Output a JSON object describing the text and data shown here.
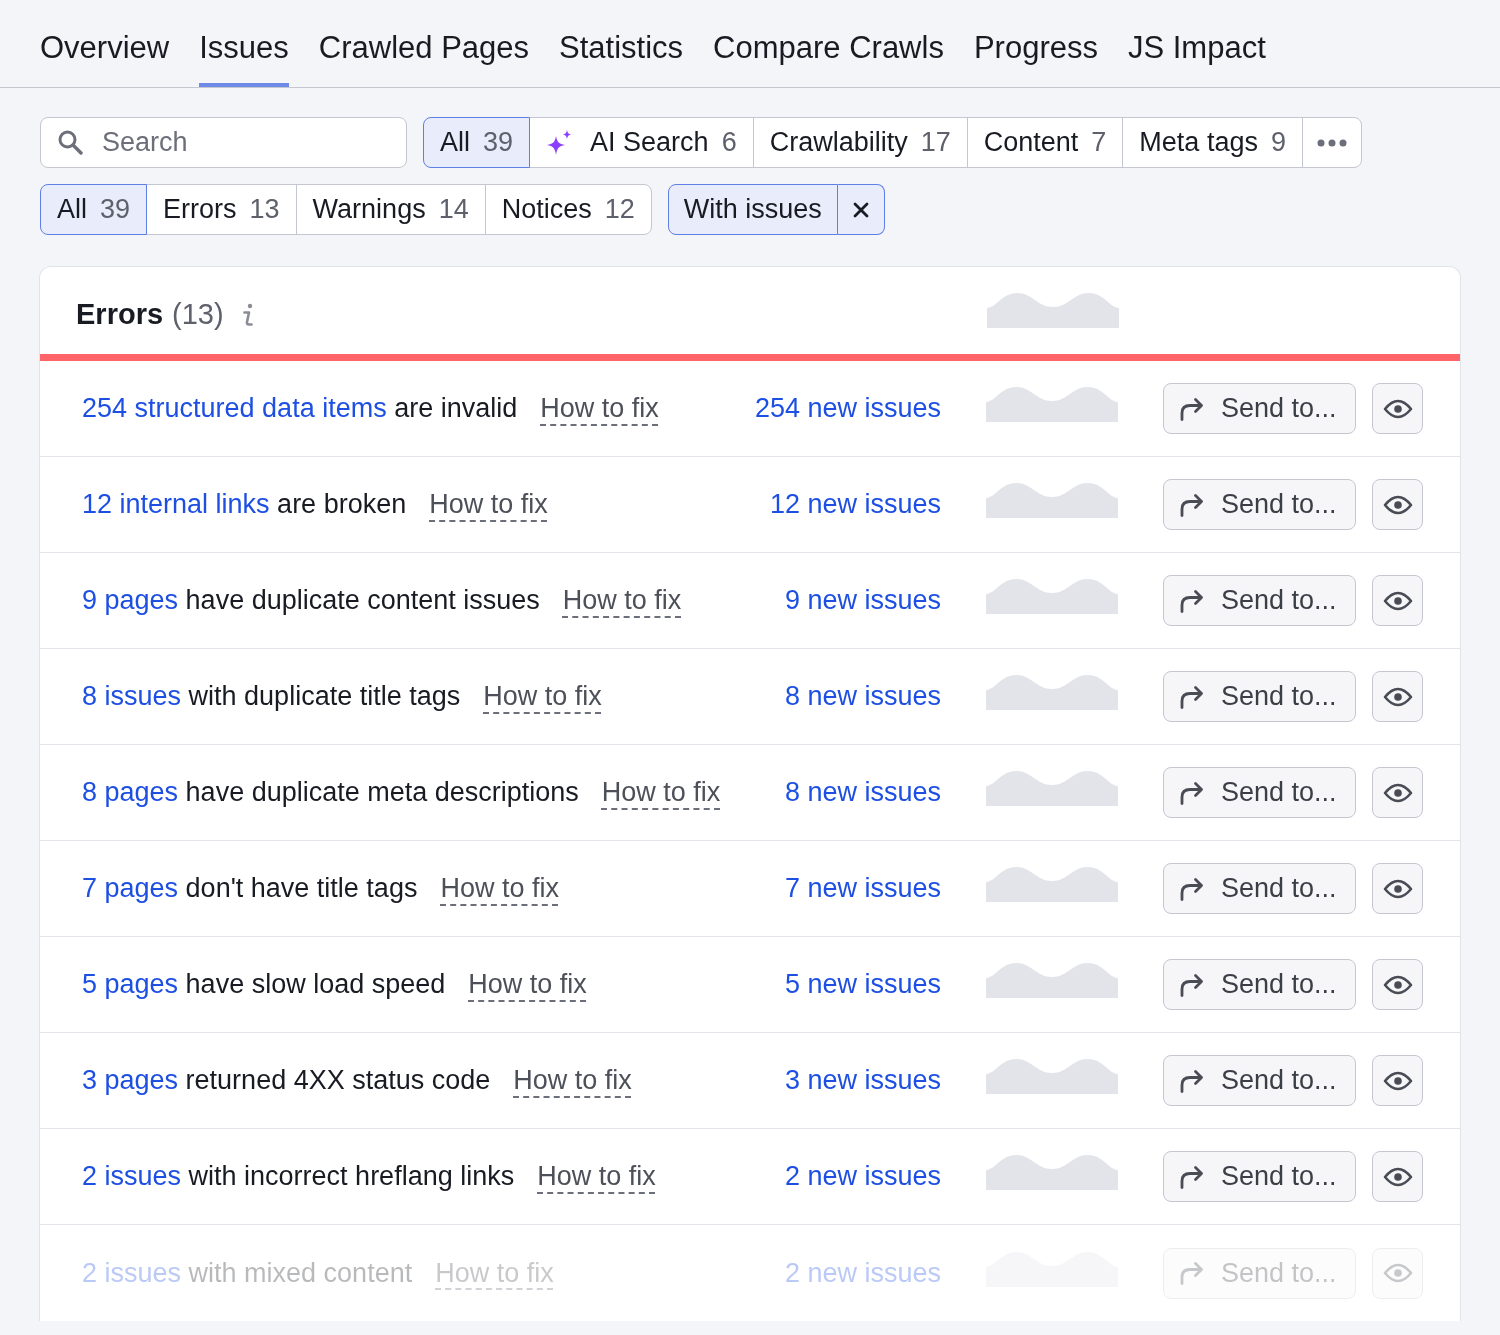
{
  "tabs": [
    {
      "label": "Overview",
      "selected": false
    },
    {
      "label": "Issues",
      "selected": true
    },
    {
      "label": "Crawled Pages",
      "selected": false
    },
    {
      "label": "Statistics",
      "selected": false
    },
    {
      "label": "Compare Crawls",
      "selected": false
    },
    {
      "label": "Progress",
      "selected": false
    },
    {
      "label": "JS Impact",
      "selected": false
    }
  ],
  "search": {
    "placeholder": "Search"
  },
  "category_filters": [
    {
      "kind": "plain",
      "label": "All",
      "count": "39",
      "selected": true
    },
    {
      "kind": "ai",
      "label": "AI Search",
      "count": "6",
      "selected": false
    },
    {
      "kind": "plain",
      "label": "Crawlability",
      "count": "17",
      "selected": false
    },
    {
      "kind": "plain",
      "label": "Content",
      "count": "7",
      "selected": false
    },
    {
      "kind": "plain",
      "label": "Meta tags",
      "count": "9",
      "selected": false
    }
  ],
  "severity_filters": [
    {
      "label": "All",
      "count": "39",
      "selected": true
    },
    {
      "label": "Errors",
      "count": "13",
      "selected": false
    },
    {
      "label": "Warnings",
      "count": "14",
      "selected": false
    },
    {
      "label": "Notices",
      "count": "12",
      "selected": false
    }
  ],
  "active_filter": {
    "label": "With issues"
  },
  "errors_section": {
    "title": "Errors",
    "count": "(13)",
    "rows": [
      {
        "link": "254 structured data items",
        "text": "are invalid",
        "fix_link": "How to fix",
        "new_issues": "254 new issues",
        "send_button": "Send to..."
      },
      {
        "link": "12 internal links",
        "text": "are broken",
        "fix_link": "How to fix",
        "new_issues": "12 new issues",
        "send_button": "Send to..."
      },
      {
        "link": "9 pages",
        "text": "have duplicate content issues",
        "fix_link": "How to fix",
        "new_issues": "9 new issues",
        "send_button": "Send to..."
      },
      {
        "link": "8 issues",
        "text": "with duplicate title tags",
        "fix_link": "How to fix",
        "new_issues": "8 new issues",
        "send_button": "Send to..."
      },
      {
        "link": "8 pages",
        "text": "have duplicate meta descriptions",
        "fix_link": "How to fix",
        "new_issues": "8 new issues",
        "send_button": "Send to..."
      },
      {
        "link": "7 pages",
        "text": "don't have title tags",
        "fix_link": "How to fix",
        "new_issues": "7 new issues",
        "send_button": "Send to..."
      },
      {
        "link": "5 pages",
        "text": "have slow load speed",
        "fix_link": "How to fix",
        "new_issues": "5 new issues",
        "send_button": "Send to..."
      },
      {
        "link": "3 pages",
        "text": "returned 4XX status code",
        "fix_link": "How to fix",
        "new_issues": "3 new issues",
        "send_button": "Send to..."
      },
      {
        "link": "2 issues",
        "text": "with incorrect hreflang links",
        "fix_link": "How to fix",
        "new_issues": "2 new issues",
        "send_button": "Send to..."
      },
      {
        "link": "2 issues",
        "text": "with mixed content",
        "fix_link": "How to fix",
        "new_issues": "2 new issues",
        "send_button": "Send to..."
      }
    ]
  }
}
